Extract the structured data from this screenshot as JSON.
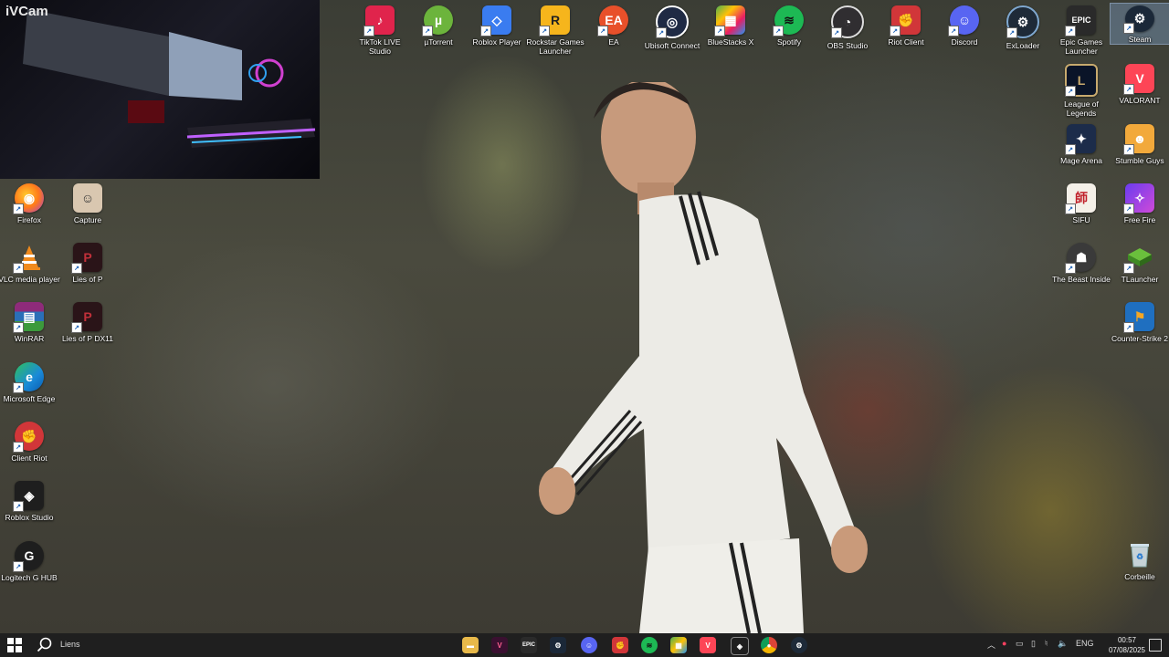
{
  "webcam": {
    "label": "iVCam"
  },
  "desktop_icons": {
    "tiktok": "TikTok LIVE Studio",
    "utorrent": "µTorrent",
    "roblox_player": "Roblox Player",
    "rockstar": "Rockstar Games Launcher",
    "ea": "EA",
    "ubisoft": "Ubisoft Connect",
    "bluestacks": "BlueStacks X",
    "spotify": "Spotify",
    "obs": "OBS Studio",
    "riot_client": "Riot Client",
    "discord": "Discord",
    "exloader": "ExLoader",
    "epic": "Epic Games Launcher",
    "steam": "Steam",
    "lol": "League of Legends",
    "valorant": "VALORANT",
    "mage_arena": "Mage Arena",
    "stumble_guys": "Stumble Guys",
    "sifu": "SIFU",
    "free_fire": "Free Fire",
    "beast_inside": "The Beast Inside",
    "tlauncher": "TLauncher",
    "cs2": "Counter-Strike 2",
    "recycle_bin": "Corbeille",
    "firefox": "Firefox",
    "capture": "Capture",
    "vlc": "VLC media player",
    "lies_of_p": "Lies of P",
    "winrar": "WinRAR",
    "lies_of_p_dx11": "Lies of P DX11",
    "edge": "Microsoft Edge",
    "client_riot": "Client Riot",
    "roblox_studio": "Roblox Studio",
    "logitech": "Logitech G HUB"
  },
  "taskbar": {
    "links_label": "Liens",
    "language": "ENG",
    "time": "00:57",
    "date": "07/08/2025",
    "epic_glyph": "EPIC"
  },
  "colors": {
    "taskbar_bg": "#1f1f1f",
    "accent": "#0078d4"
  }
}
